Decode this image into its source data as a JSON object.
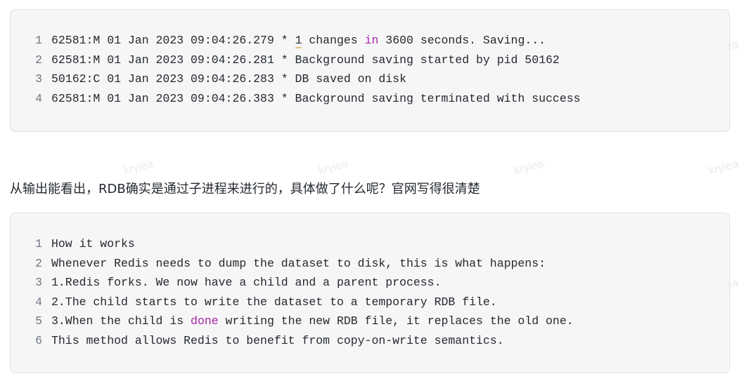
{
  "code_block_1": {
    "lines": [
      {
        "num": "1",
        "parts": [
          "62581:M 01 Jan 2023 09:04:26.279 * ",
          "1",
          " changes ",
          "in",
          " 3600 seconds. Saving..."
        ]
      },
      {
        "num": "2",
        "text": "62581:M 01 Jan 2023 09:04:26.281 * Background saving started by pid 50162"
      },
      {
        "num": "3",
        "text": "50162:C 01 Jan 2023 09:04:26.283 * DB saved on disk"
      },
      {
        "num": "4",
        "text": "62581:M 01 Jan 2023 09:04:26.383 * Background saving terminated with success"
      }
    ]
  },
  "paragraph": "从输出能看出，RDB确实是通过子进程来进行的，具体做了什么呢？官网写得很清楚",
  "code_block_2": {
    "lines": [
      {
        "num": "1",
        "text": "How it works"
      },
      {
        "num": "2",
        "text": "Whenever Redis needs to dump the dataset to disk, this is what happens:"
      },
      {
        "num": "3",
        "text": "1.Redis forks. We now have a child and a parent process."
      },
      {
        "num": "4",
        "text": "2.The child starts to write the dataset to a temporary RDB file."
      },
      {
        "num": "5",
        "parts": [
          "3.When the child is ",
          "done",
          " writing the new RDB file, it replaces the old one."
        ]
      },
      {
        "num": "6",
        "text": "This method allows Redis to benefit from copy-on-write semantics."
      }
    ]
  },
  "watermark": "kryiea",
  "colors": {
    "keyword": "#a626a4",
    "code_bg": "#f6f6f7",
    "text": "#24292f",
    "line_number": "#6e7781"
  }
}
